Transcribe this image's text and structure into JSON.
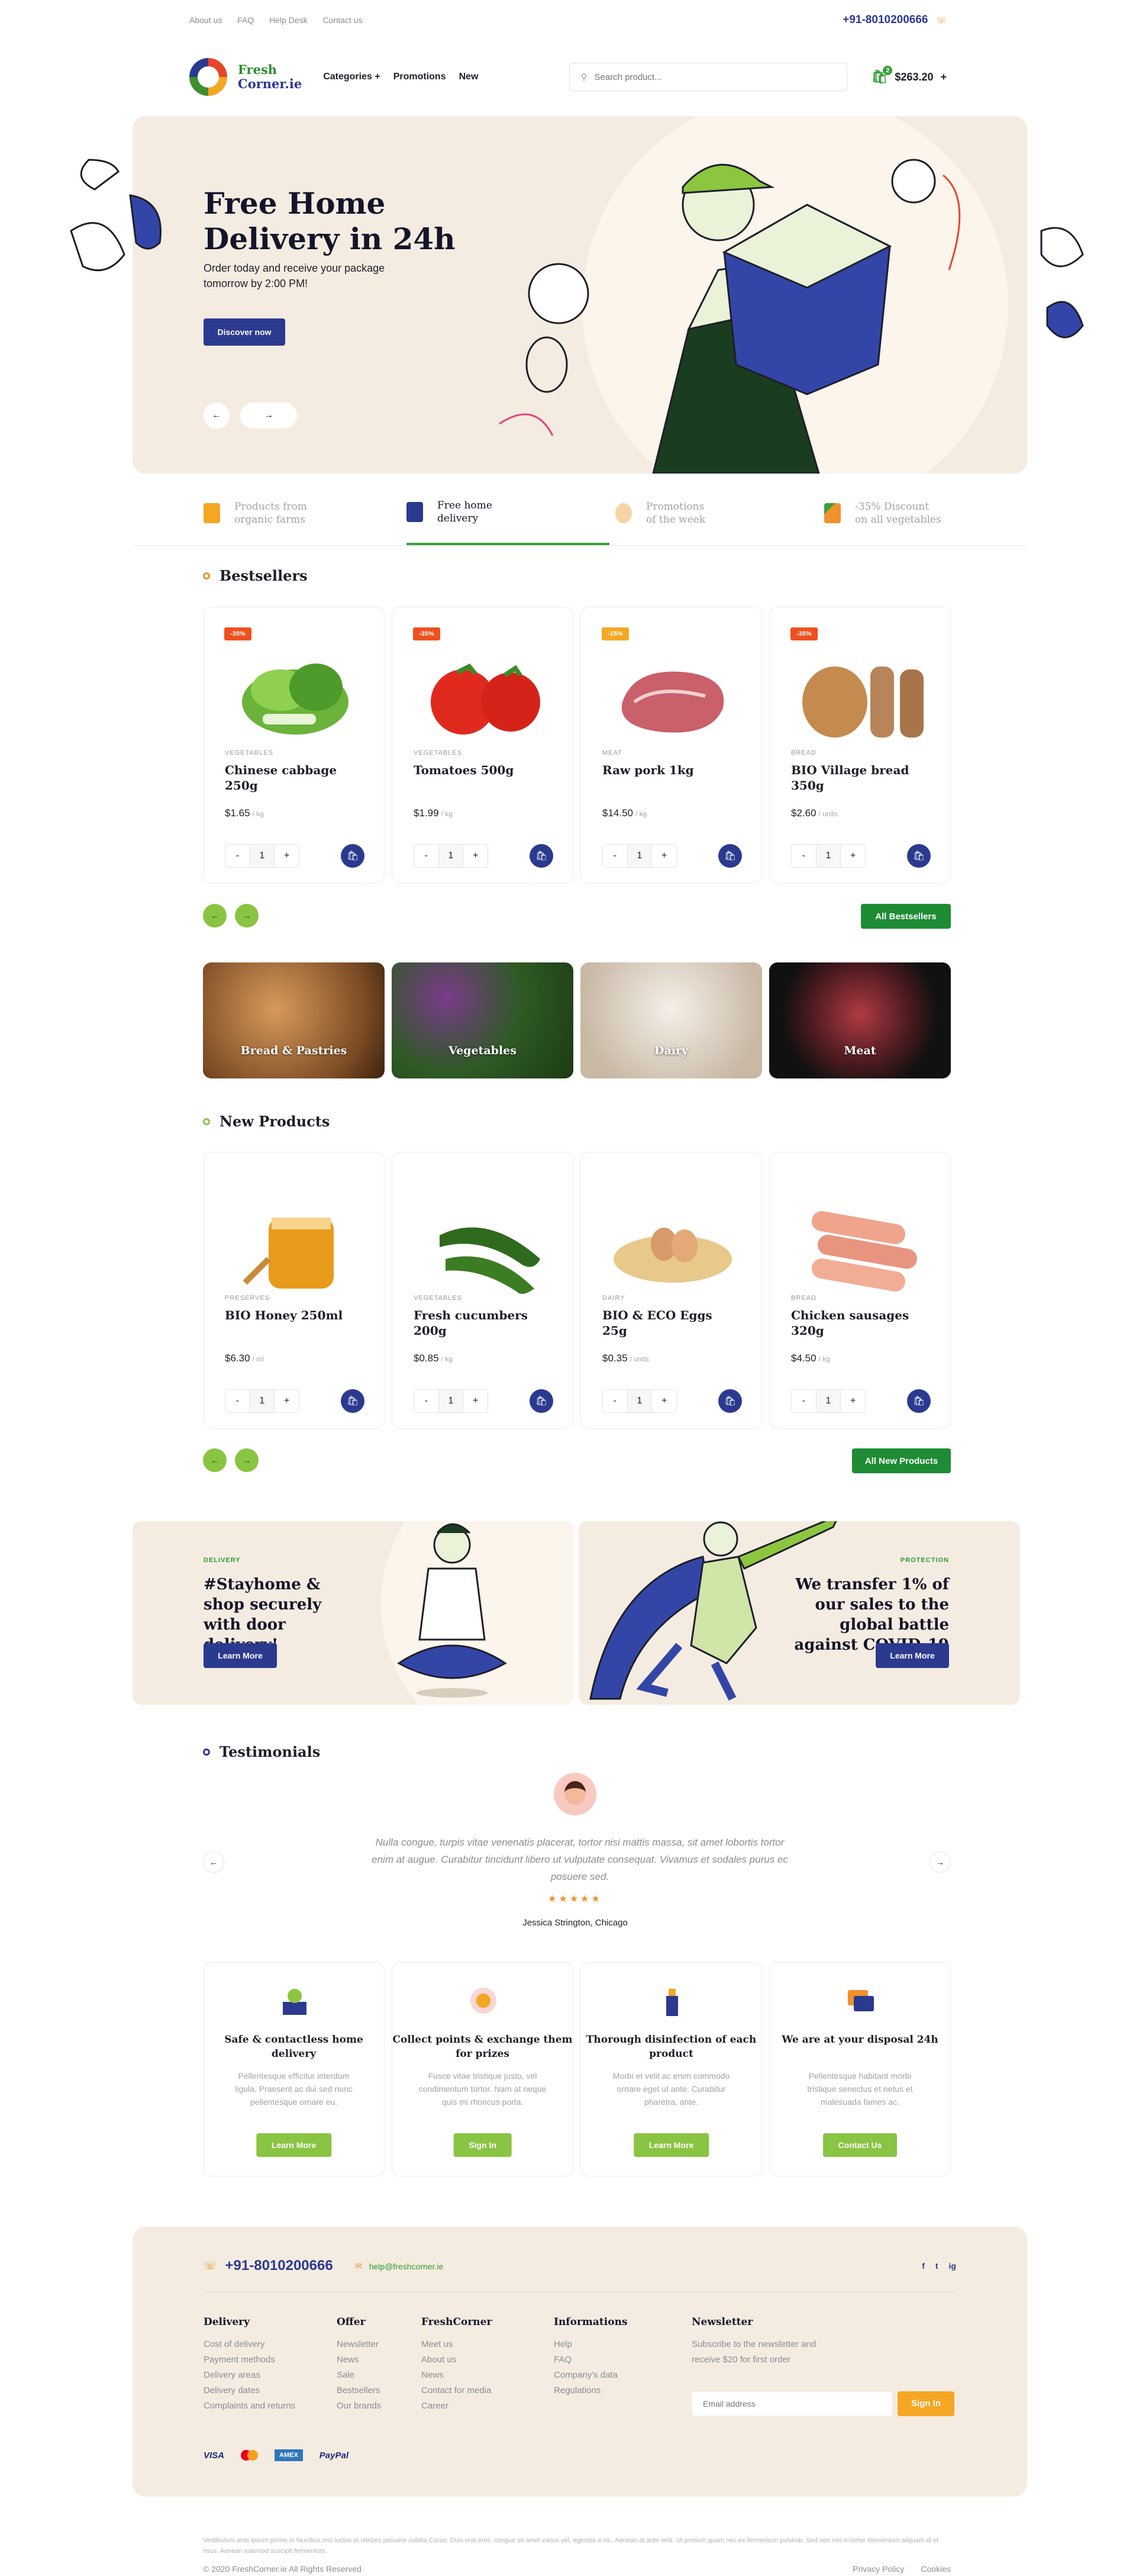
{
  "topbar": {
    "links": [
      "About us",
      "FAQ",
      "Help Desk",
      "Contact us"
    ],
    "phone": "+91-8010200666"
  },
  "header": {
    "logo_line1": "Fresh",
    "logo_line2": "Corner.ie",
    "nav": [
      "Categories",
      "Promotions",
      "New"
    ],
    "search_placeholder": "Search product...",
    "cart_total": "$263.20",
    "cart_count": "2"
  },
  "hero": {
    "title_line1": "Free Home",
    "title_line2": "Delivery  in 24h",
    "subtitle": "Order today and receive your package tomorrow by 2:00 PM!",
    "cta": "Discover now"
  },
  "tabs": [
    {
      "l1": "Products from",
      "l2": "organic farms"
    },
    {
      "l1": "Free home",
      "l2": "delivery"
    },
    {
      "l1": "Promotions",
      "l2": "of the week"
    },
    {
      "l1": "-35% Discount",
      "l2": "on all vegetables"
    }
  ],
  "bestsellers": {
    "title": "Bestsellers",
    "button": "All Bestsellers",
    "items": [
      {
        "badge": "-35%",
        "cat": "Vegetables",
        "name": "Chinese cabbage 250g",
        "price": "$1.65",
        "unit": "/ kg",
        "qty": "1"
      },
      {
        "badge": "-35%",
        "cat": "Vegetables",
        "name": "Tomatoes 500g",
        "price": "$1.99",
        "unit": "/ kg",
        "qty": "1"
      },
      {
        "badge": "-15%",
        "cat": "Meat",
        "name": "Raw pork 1kg",
        "price": "$14.50",
        "unit": "/ kg",
        "qty": "1"
      },
      {
        "badge": "-35%",
        "cat": "Bread",
        "name": "BIO Village bread 350g",
        "price": "$2.60",
        "unit": "/ units",
        "qty": "1"
      }
    ]
  },
  "categories": [
    "Bread & Pastries",
    "Vegetables",
    "Dairy",
    "Meat"
  ],
  "new_products": {
    "title": "New Products",
    "button": "All New Products",
    "items": [
      {
        "cat": "Preserves",
        "name": "BIO Honey 250ml",
        "price": "$6.30",
        "unit": "/ ml",
        "qty": "1"
      },
      {
        "cat": "Vegetables",
        "name": "Fresh cucumbers 200g",
        "price": "$0.85",
        "unit": "/ kg",
        "qty": "1"
      },
      {
        "cat": "Dairy",
        "name": "BIO & ECO Eggs 25g",
        "price": "$0.35",
        "unit": "/ units",
        "qty": "1"
      },
      {
        "cat": "Bread",
        "name": "Chicken sausages 320g",
        "price": "$4.50",
        "unit": "/ kg",
        "qty": "1"
      }
    ]
  },
  "promo": [
    {
      "label": "DELIVERY",
      "title": "#Stayhome & shop securely with door delivery!",
      "button": "Learn More"
    },
    {
      "label": "PROTECTION",
      "title": "We transfer 1% of our sales to the global battle against COVID-19",
      "button": "Learn More"
    }
  ],
  "testimonials": {
    "title": "Testimonials",
    "quote": "Nulla congue, turpis vitae venenatis placerat, tortor nisi mattis massa, sit amet lobortis tortor enim at augue. Curabitur tincidunt libero ut vulputate consequat. Vivamus et sodales purus ec posuere sed.",
    "stars": "★★★★★",
    "author": "Jessica Strington, Chicago"
  },
  "features": [
    {
      "title": "Safe & contactless home delivery",
      "text": "Pellentesque efficitur interdum ligula. Praesent ac dui sed nunc pellentesque ornare eu.",
      "button": "Learn More"
    },
    {
      "title": "Collect points & exchange them for prizes",
      "text": "Fusce vitae tristique justo, vel condimentum tortor. Nam at neque quis mi rhoncus porta.",
      "button": "Sign In"
    },
    {
      "title": "Thorough disinfection of each product",
      "text": "Morbi et velit ac enim commodo ornare eget ut ante. Curabitur pharetra, ante.",
      "button": "Learn More"
    },
    {
      "title": "We are at your disposal 24h",
      "text": "Pellentesque habitant morbi tristique senectus et netus et malesuada fames ac.",
      "button": "Contact Us"
    }
  ],
  "footer": {
    "phone": "+91-8010200666",
    "email": "help@freshcorner.ie",
    "social": [
      "f",
      "t",
      "ig"
    ],
    "cols": [
      {
        "title": "Delivery",
        "items": [
          "Cost of delivery",
          "Payment methods",
          "Delivery areas",
          "Delivery dates",
          "Complaints and returns"
        ]
      },
      {
        "title": "Offer",
        "items": [
          "Newsletter",
          "News",
          "Sale",
          "Bestsellers",
          "Our brands"
        ]
      },
      {
        "title": "FreshCorner",
        "items": [
          "Meet us",
          "About us",
          "News",
          "Contact for media",
          "Career"
        ]
      },
      {
        "title": "Informations",
        "items": [
          "Help",
          "FAQ",
          "Company's data",
          "Regulations"
        ]
      }
    ],
    "newsletter": {
      "title": "Newsletter",
      "text": "Subscribe to the newsletter and receive $20 for first order",
      "placeholder": "Email address",
      "button": "Sign In"
    },
    "payments": [
      "VISA",
      "MC",
      "AMEX",
      "PayPal"
    ]
  },
  "bottom": {
    "legal": "Vestibulum ante ipsum primis in faucibus orci luctus et ultrices posuere cubilia Curae; Duis erat eros, congue sit amet varius vel, egestas a mi.. Aenean at ante velit. Ut pretium quam nec ex fermentum pulvinar. Sed non nisi in tortor elementum aliquam id et risus. Aenean euismod suscipit fermentum.",
    "copyright": "© 2020 FreshCorner.ie All Rights Reserved",
    "links": [
      "Privacy Policy",
      "Cookies"
    ]
  }
}
